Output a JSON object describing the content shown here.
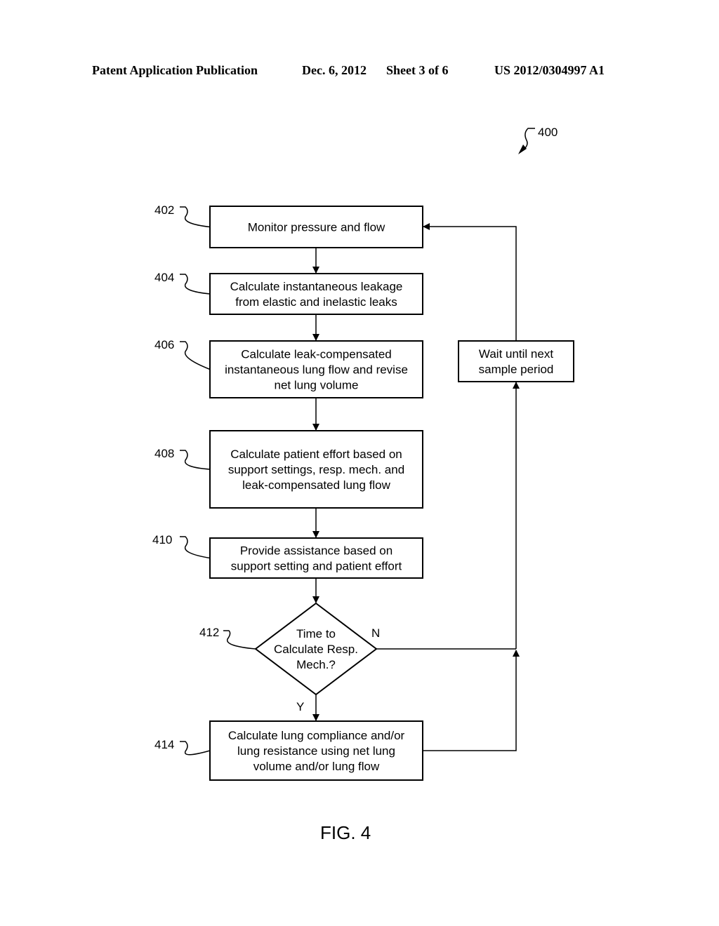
{
  "header": {
    "publication": "Patent Application Publication",
    "date": "Dec. 6, 2012",
    "sheet": "Sheet 3 of 6",
    "number": "US 2012/0304997 A1"
  },
  "figure": {
    "ref": "400",
    "caption": "FIG. 4",
    "steps": [
      {
        "ref": "402",
        "lines": [
          "Monitor pressure and flow"
        ]
      },
      {
        "ref": "404",
        "lines": [
          "Calculate instantaneous leakage",
          "from elastic and inelastic leaks"
        ]
      },
      {
        "ref": "406",
        "lines": [
          "Calculate leak-compensated",
          "instantaneous lung flow and revise",
          "net lung volume"
        ]
      },
      {
        "ref": "408",
        "lines": [
          "Calculate patient effort based on",
          "support settings, resp. mech. and",
          "leak-compensated lung flow"
        ]
      },
      {
        "ref": "410",
        "lines": [
          "Provide assistance based on",
          "support setting and patient effort"
        ]
      },
      {
        "ref": "412",
        "lines": [
          "Time to",
          "Calculate Resp.",
          "Mech.?"
        ]
      },
      {
        "ref": "414",
        "lines": [
          "Calculate lung compliance and/or",
          "lung resistance using net lung",
          "volume and/or lung flow"
        ]
      }
    ],
    "wait_box": {
      "lines": [
        "Wait until next",
        "sample period"
      ]
    },
    "branch_yes": "Y",
    "branch_no": "N"
  }
}
